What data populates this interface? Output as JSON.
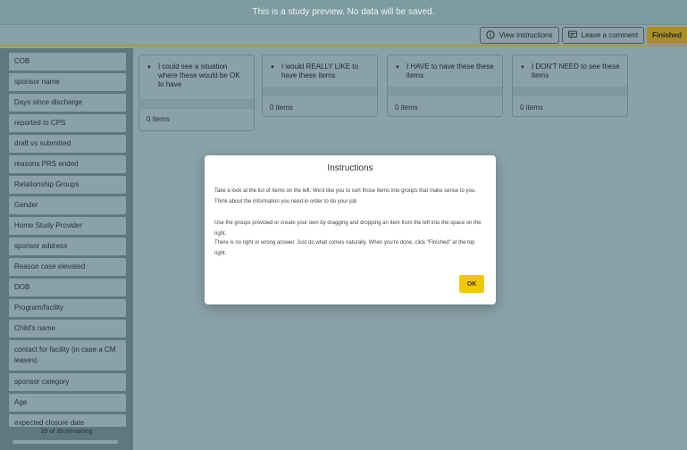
{
  "banner": {
    "text": "This is a study preview. No data will be saved."
  },
  "toolbar": {
    "view_instructions": "View instructions",
    "leave_comment": "Leave a comment",
    "finished": "Finished"
  },
  "sidebar": {
    "items": [
      "COB",
      "sponsor name",
      "Days since discharge",
      "reported to CPS",
      "draft vs submitted",
      "reasons PRS ended",
      "Relationship Groups",
      "Gender",
      "Home Study Provider",
      "sponsor address",
      "Reason case elevated",
      "DOB",
      "Program/facility",
      "Child's name",
      "contact for facility (in case a CM leaves)",
      "sponsor category",
      "Age",
      "expected closure date"
    ],
    "remaining": "39 of 39 remaining",
    "progress_fraction": 0
  },
  "groups": [
    {
      "title": "I could see a situation where these would be OK to have",
      "count": "0 items"
    },
    {
      "title": "I would REALLY LIKE to have these items",
      "count": "0 items"
    },
    {
      "title": "I HAVE to have these these items",
      "count": "0 items"
    },
    {
      "title": "I DON'T NEED to see these items",
      "count": "0 items"
    }
  ],
  "modal": {
    "title": "Instructions",
    "paragraphs": [
      "Take a look at the list of items on the left. We'd like you to sort those items into groups that make sense to you. Think about the information you need in order to do your job",
      "Use the groups provided or create your own by dragging and dropping an item from the left into the space on the right.",
      "There is no right or wrong answer. Just do what comes naturally. When you're done, click \"Finished\" at the top right."
    ],
    "ok_label": "OK"
  },
  "icons": {
    "view_instructions": "info-circle-icon",
    "leave_comment": "comment-icon",
    "group_toggle": "caret-down-icon"
  }
}
